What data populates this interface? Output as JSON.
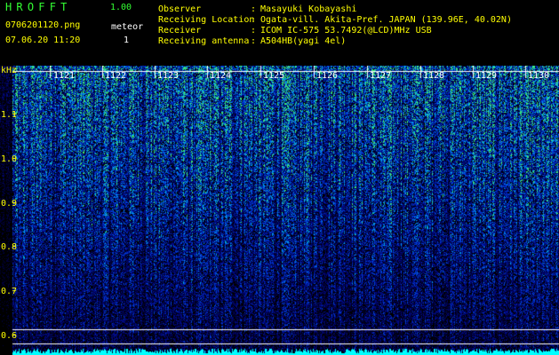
{
  "header": {
    "app_title": "HROFFT",
    "version": "1.00",
    "filename": "0706201120.png",
    "datetime": "07.06.20 11:20",
    "meteor_label": "meteor",
    "meteor_count": "1"
  },
  "station_info": [
    {
      "label": "Observer",
      "value": "Masayuki Kobayashi"
    },
    {
      "label": "Receiving Location",
      "value": "Ogata-vill. Akita-Pref. JAPAN (139.96E, 40.02N)"
    },
    {
      "label": "Receiver",
      "value": "ICOM IC-575 53.7492(@LCD)MHz USB"
    },
    {
      "label": "Receiving antenna",
      "value": "A504HB(yagi 4el)"
    }
  ],
  "plot": {
    "y_unit": "kHz",
    "y_ticks": [
      "1.1",
      "1.0",
      "0.9",
      "0.8",
      "0.7",
      "0.6"
    ],
    "time_labels": [
      "1121",
      "1122",
      "1123",
      "1124",
      "1125",
      "1126",
      "1127",
      "1128",
      "1129",
      "1130"
    ],
    "colors": {
      "text": "#ffff00",
      "grid": "#ffffff",
      "signal": "#00ffff",
      "label_green": "#33ff33"
    }
  }
}
